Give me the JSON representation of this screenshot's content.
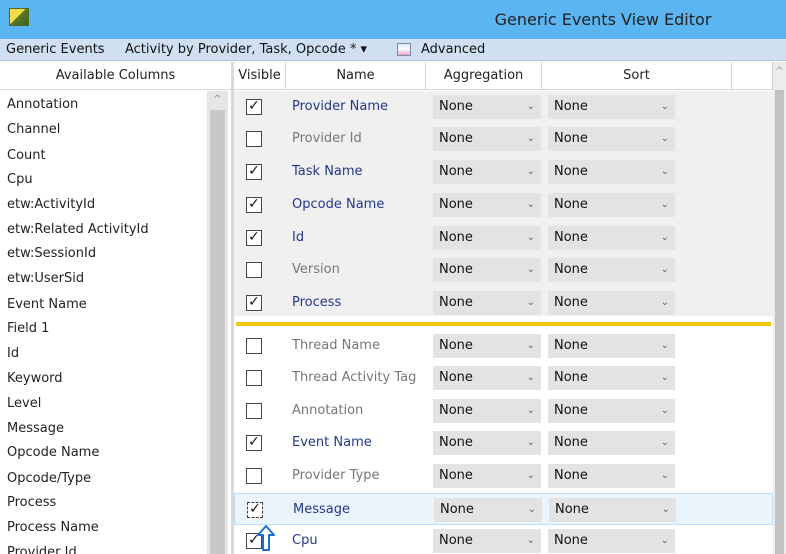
{
  "window": {
    "title": "Generic Events View Editor"
  },
  "menu": {
    "generic_events": "Generic Events",
    "preset": "Activity by Provider, Task, Opcode * ▾",
    "advanced": "Advanced"
  },
  "left_panel": {
    "header": "Available Columns",
    "items": [
      "Annotation",
      "Channel",
      "Count",
      "Cpu",
      "etw:ActivityId",
      "etw:Related ActivityId",
      "etw:SessionId",
      "etw:UserSid",
      "Event Name",
      "Field 1",
      "Id",
      "Keyword",
      "Level",
      "Message",
      "Opcode Name",
      "Opcode/Type",
      "Process",
      "Process Name",
      "Provider Id"
    ]
  },
  "columns": {
    "visible": "Visible",
    "name": "Name",
    "aggregation": "Aggregation",
    "sort": "Sort"
  },
  "rows": [
    {
      "name": "Provider Name",
      "visible": true,
      "aggregation": "None",
      "sort": "None",
      "mark": "✓"
    },
    {
      "name": "Provider Id",
      "visible": false,
      "aggregation": "None",
      "sort": "None",
      "mark": ""
    },
    {
      "name": "Task Name",
      "visible": true,
      "aggregation": "None",
      "sort": "None",
      "mark": "✓"
    },
    {
      "name": "Opcode Name",
      "visible": true,
      "aggregation": "None",
      "sort": "None",
      "mark": "✓"
    },
    {
      "name": "Id",
      "visible": true,
      "aggregation": "None",
      "sort": "None",
      "mark": "✓"
    },
    {
      "name": "Version",
      "visible": false,
      "aggregation": "None",
      "sort": "None",
      "mark": ""
    },
    {
      "name": "Process",
      "visible": true,
      "aggregation": "None",
      "sort": "None",
      "mark": "✓"
    },
    {
      "name": "Thread Name",
      "visible": false,
      "aggregation": "None",
      "sort": "None",
      "mark": ""
    },
    {
      "name": "Thread Activity Tag",
      "visible": false,
      "aggregation": "None",
      "sort": "None",
      "mark": ""
    },
    {
      "name": "Annotation",
      "visible": false,
      "aggregation": "None",
      "sort": "None",
      "mark": ""
    },
    {
      "name": "Event Name",
      "visible": true,
      "aggregation": "None",
      "sort": "None",
      "mark": "✓"
    },
    {
      "name": "Provider Type",
      "visible": false,
      "aggregation": "None",
      "sort": "None",
      "mark": ""
    },
    {
      "name": "Message",
      "visible": true,
      "aggregation": "None",
      "sort": "None",
      "mark": "✓"
    },
    {
      "name": "Cpu",
      "visible": true,
      "aggregation": "None",
      "sort": "None",
      "mark": "✓"
    }
  ],
  "colors": {
    "title_bar": "#5bb5f0",
    "menu_bar": "#cfe1f1",
    "grouping_line": "#f2c811",
    "visible_name": "#23388a",
    "hidden_name": "#777777"
  }
}
